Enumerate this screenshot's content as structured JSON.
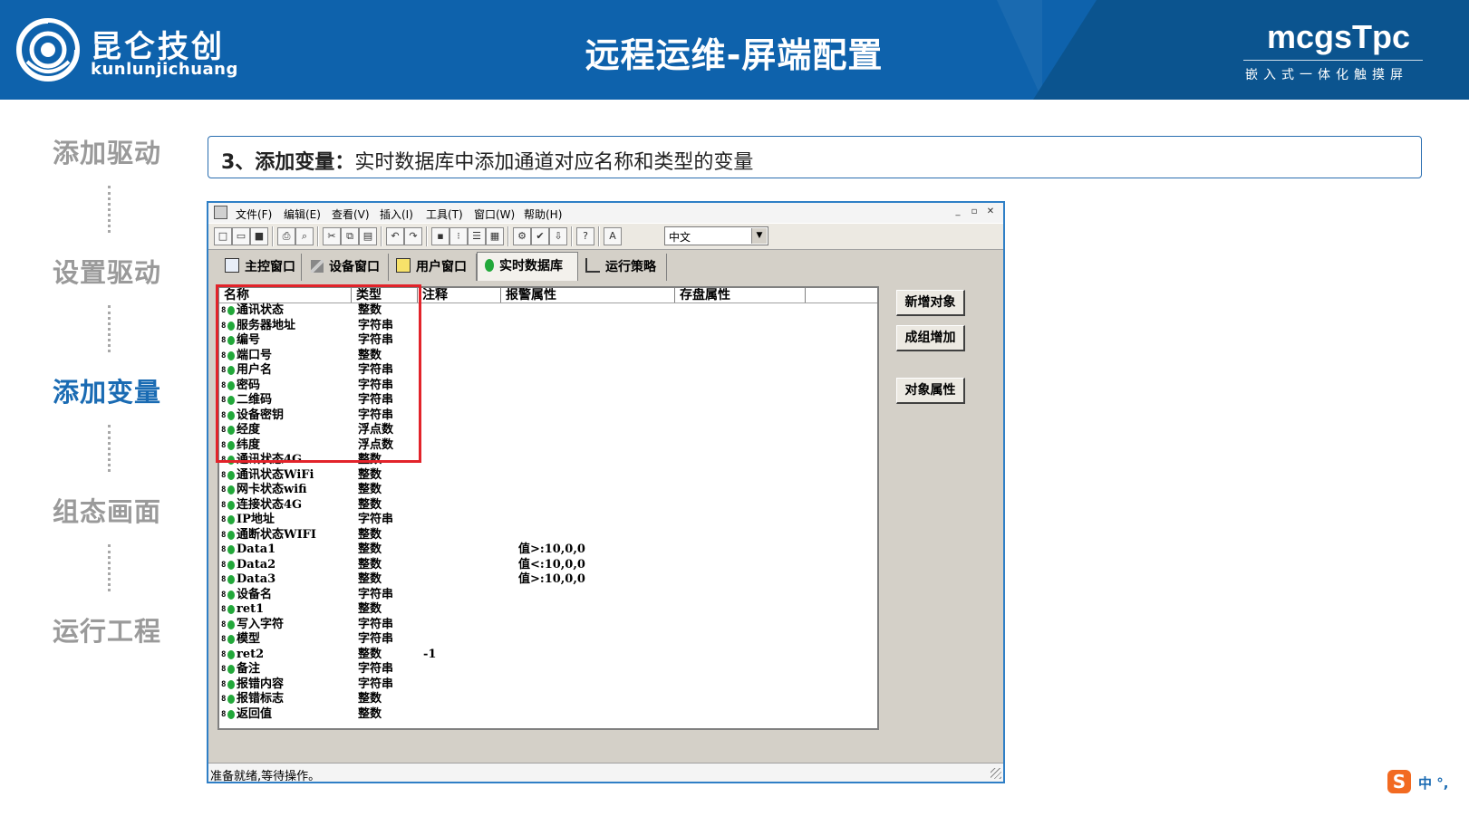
{
  "header": {
    "brand_cn": "昆仑技创",
    "brand_en": "kunlunjichuang",
    "title": "远程运维-屏端配置",
    "brand_right": "mcgsTpc",
    "brand_right_sub": "嵌入式一体化触摸屏"
  },
  "steps": [
    {
      "label": "添加驱动",
      "active": false
    },
    {
      "label": "设置驱动",
      "active": false
    },
    {
      "label": "添加变量",
      "active": true
    },
    {
      "label": "组态画面",
      "active": false
    },
    {
      "label": "运行工程",
      "active": false
    }
  ],
  "caption": {
    "prefix": "3、添加变量：",
    "text": "实时数据库中添加通道对应名称和类型的变量"
  },
  "app": {
    "menu": [
      "文件(F)",
      "编辑(E)",
      "查看(V)",
      "插入(I)",
      "工具(T)",
      "窗口(W)",
      "帮助(H)"
    ],
    "language": "中文",
    "tabs": [
      "主控窗口",
      "设备窗口",
      "用户窗口",
      "实时数据库",
      "运行策略"
    ],
    "active_tab": "实时数据库",
    "columns": [
      "名称",
      "类型",
      "注释",
      "报警属性",
      "存盘属性"
    ],
    "rows": [
      {
        "name": "通讯状态",
        "type": "整数",
        "note": "",
        "alarm": ""
      },
      {
        "name": "服务器地址",
        "type": "字符串",
        "note": "",
        "alarm": ""
      },
      {
        "name": "编号",
        "type": "字符串",
        "note": "",
        "alarm": ""
      },
      {
        "name": "端口号",
        "type": "整数",
        "note": "",
        "alarm": ""
      },
      {
        "name": "用户名",
        "type": "字符串",
        "note": "",
        "alarm": ""
      },
      {
        "name": "密码",
        "type": "字符串",
        "note": "",
        "alarm": ""
      },
      {
        "name": "二维码",
        "type": "字符串",
        "note": "",
        "alarm": ""
      },
      {
        "name": "设备密钥",
        "type": "字符串",
        "note": "",
        "alarm": ""
      },
      {
        "name": "经度",
        "type": "浮点数",
        "note": "",
        "alarm": ""
      },
      {
        "name": "纬度",
        "type": "浮点数",
        "note": "",
        "alarm": ""
      },
      {
        "name": "通讯状态4G",
        "type": "整数",
        "note": "",
        "alarm": ""
      },
      {
        "name": "通讯状态WiFi",
        "type": "整数",
        "note": "",
        "alarm": ""
      },
      {
        "name": "网卡状态wifi",
        "type": "整数",
        "note": "",
        "alarm": ""
      },
      {
        "name": "连接状态4G",
        "type": "整数",
        "note": "",
        "alarm": ""
      },
      {
        "name": "IP地址",
        "type": "字符串",
        "note": "",
        "alarm": ""
      },
      {
        "name": "通断状态WIFI",
        "type": "整数",
        "note": "",
        "alarm": ""
      },
      {
        "name": "Data1",
        "type": "整数",
        "note": "",
        "alarm": "值>:10,0,0"
      },
      {
        "name": "Data2",
        "type": "整数",
        "note": "",
        "alarm": "值<:10,0,0"
      },
      {
        "name": "Data3",
        "type": "整数",
        "note": "",
        "alarm": "值>:10,0,0"
      },
      {
        "name": "设备名",
        "type": "字符串",
        "note": "",
        "alarm": ""
      },
      {
        "name": "ret1",
        "type": "整数",
        "note": "",
        "alarm": ""
      },
      {
        "name": "写入字符",
        "type": "字符串",
        "note": "",
        "alarm": ""
      },
      {
        "name": "模型",
        "type": "字符串",
        "note": "",
        "alarm": ""
      },
      {
        "name": "ret2",
        "type": "整数",
        "note": "-1",
        "alarm": ""
      },
      {
        "name": "备注",
        "type": "字符串",
        "note": "",
        "alarm": ""
      },
      {
        "name": "报错内容",
        "type": "字符串",
        "note": "",
        "alarm": ""
      },
      {
        "name": "报错标志",
        "type": "整数",
        "note": "",
        "alarm": ""
      },
      {
        "name": "返回值",
        "type": "整数",
        "note": "",
        "alarm": ""
      }
    ],
    "buttons": {
      "add_object": "新增对象",
      "group_add": "成组增加",
      "object_props": "对象属性"
    },
    "status": "准备就绪,等待操作。"
  },
  "ime": {
    "logo": "S",
    "text": "中 °,"
  },
  "colors": {
    "header_blue": "#0e62ac",
    "active_step": "#1a6bb3",
    "highlight_red": "#e2232a"
  }
}
